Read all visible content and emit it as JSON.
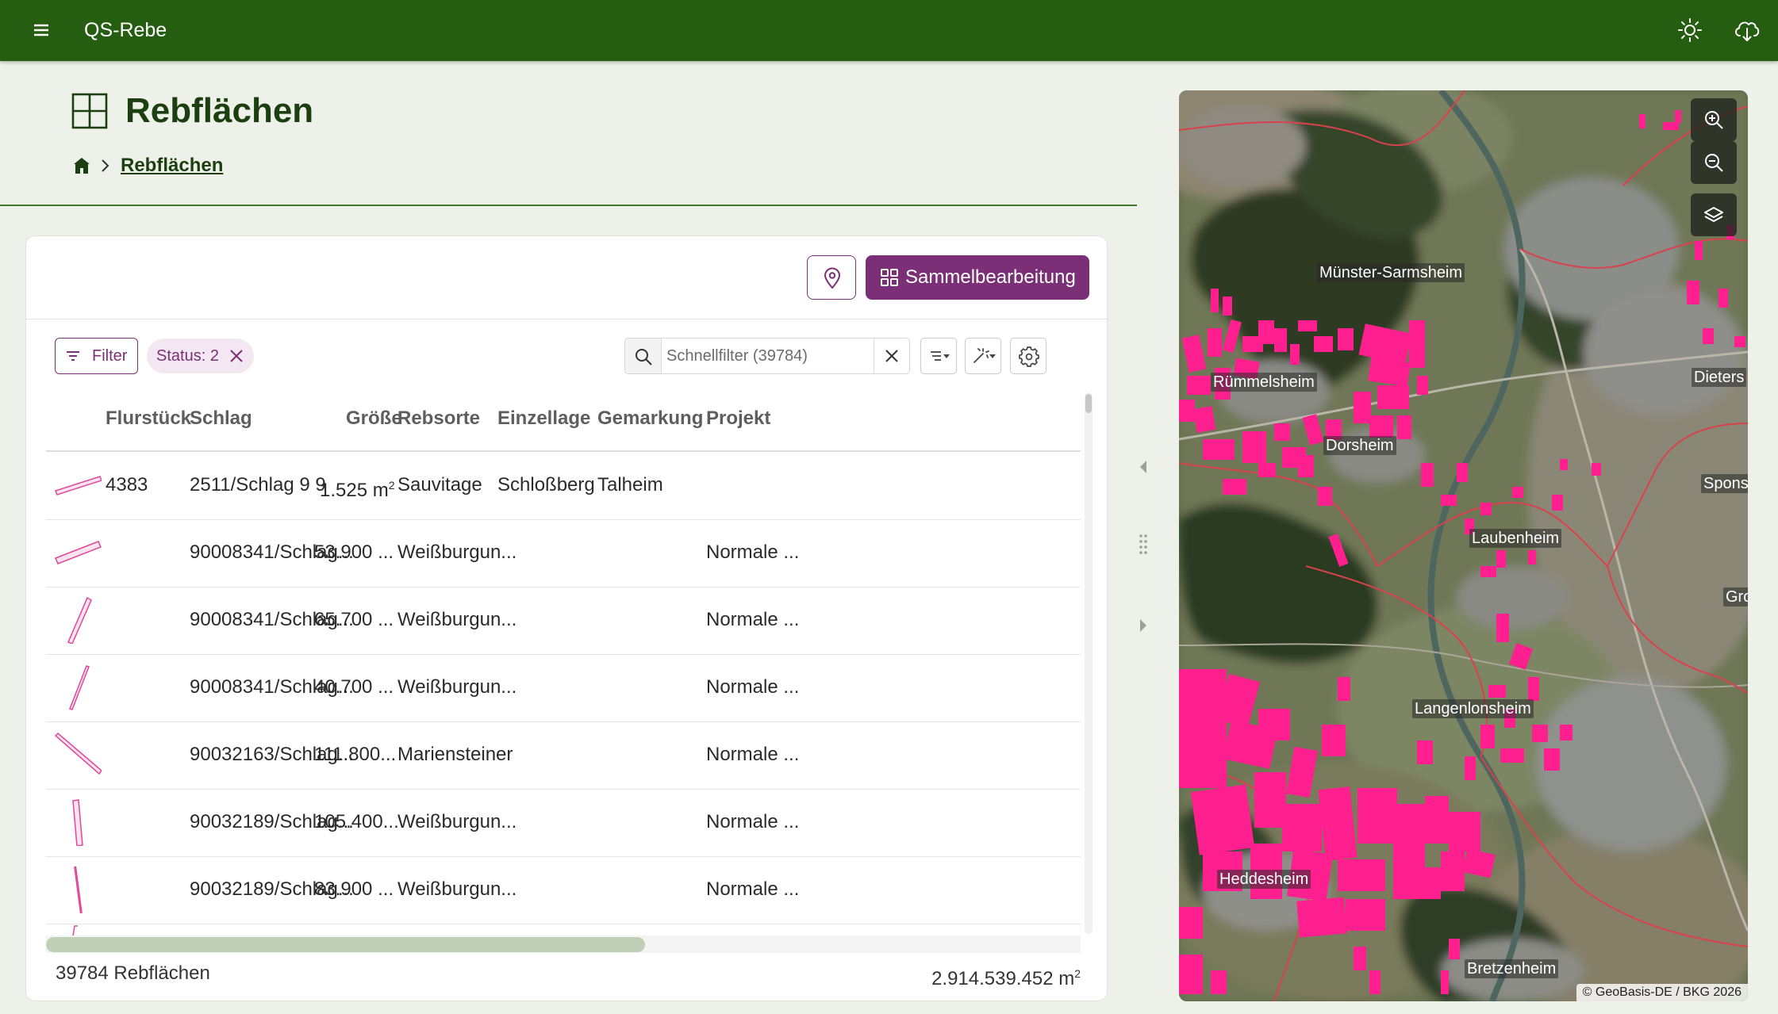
{
  "app": {
    "title": "QS-Rebe"
  },
  "page": {
    "title": "Rebflächen",
    "breadcrumb": "Rebflächen"
  },
  "toolbar": {
    "bulk_edit_label": "Sammelbearbeitung"
  },
  "filters": {
    "filter_label": "Filter",
    "status_chip": "Status: 2",
    "search_placeholder": "Schnellfilter (39784)"
  },
  "table": {
    "columns": [
      "Flurstück",
      "Schlag",
      "Größe",
      "Rebsorte",
      "Einzellage",
      "Gemarkung",
      "Projekt"
    ],
    "rows": [
      {
        "flurstueck": "4383",
        "schlag": "2511/Schlag 9 9",
        "groesse": "1.525 m",
        "groesse_sup": "2",
        "rebsorte": "Sauvitage",
        "einzellage": "Schloßberg",
        "gemarkung": "Talheim",
        "projekt": ""
      },
      {
        "flurstueck": "",
        "schlag": "90008341/Schlag...",
        "groesse": "53.900 ...",
        "groesse_sup": "",
        "rebsorte": "Weißburgun...",
        "einzellage": "",
        "gemarkung": "",
        "projekt": "Normale ..."
      },
      {
        "flurstueck": "",
        "schlag": "90008341/Schlag...",
        "groesse": "65.700 ...",
        "groesse_sup": "",
        "rebsorte": "Weißburgun...",
        "einzellage": "",
        "gemarkung": "",
        "projekt": "Normale ..."
      },
      {
        "flurstueck": "",
        "schlag": "90008341/Schlag...",
        "groesse": "40.700 ...",
        "groesse_sup": "",
        "rebsorte": "Weißburgun...",
        "einzellage": "",
        "gemarkung": "",
        "projekt": "Normale ..."
      },
      {
        "flurstueck": "",
        "schlag": "90032163/Schlag...",
        "groesse": "111.800...",
        "groesse_sup": "",
        "rebsorte": "Mariensteiner",
        "einzellage": "",
        "gemarkung": "",
        "projekt": "Normale ..."
      },
      {
        "flurstueck": "",
        "schlag": "90032189/Schlag...",
        "groesse": "105.400...",
        "groesse_sup": "",
        "rebsorte": "Weißburgun...",
        "einzellage": "",
        "gemarkung": "",
        "projekt": "Normale ..."
      },
      {
        "flurstueck": "",
        "schlag": "90032189/Schlag...",
        "groesse": "83.900 ...",
        "groesse_sup": "",
        "rebsorte": "Weißburgun...",
        "einzellage": "",
        "gemarkung": "",
        "projekt": "Normale ..."
      }
    ]
  },
  "footer": {
    "count": "39784 Rebflächen",
    "total": "2.914.539.452 m",
    "total_sup": "2"
  },
  "map": {
    "places": [
      "Münster-Sarmsheim",
      "Rümmelsheim",
      "Dieters",
      "Dorsheim",
      "Spons",
      "Laubenheim",
      "Gro",
      "Langenlonsheim",
      "Heddesheim",
      "Bretzenheim"
    ],
    "attribution": "© GeoBasis-DE / BKG 2026"
  },
  "colors": {
    "appbar": "#255e11",
    "accent": "#7a2f76",
    "parcel": "#ff1f8e",
    "title": "#1c3f10"
  },
  "icons": [
    "menu-icon",
    "sun-icon",
    "cloud-download-icon",
    "grid-icon",
    "home-icon",
    "chevron-right-icon",
    "location-pin-icon",
    "bulk-edit-icon",
    "filter-icon",
    "close-icon",
    "search-icon",
    "sort-icon",
    "magic-wand-icon",
    "settings-icon",
    "zoom-in-icon",
    "zoom-out-icon",
    "layers-icon"
  ]
}
